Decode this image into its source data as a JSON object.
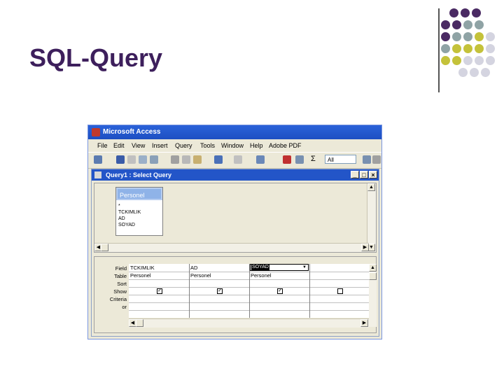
{
  "slide": {
    "title": "SQL-Query",
    "title_color": "#3d1f5c"
  },
  "app": {
    "title": "Microsoft Access",
    "menu": [
      "File",
      "Edit",
      "View",
      "Insert",
      "Query",
      "Tools",
      "Window",
      "Help",
      "Adobe PDF"
    ],
    "toolbar_combo_value": "All",
    "toolbar_sigma": "Σ"
  },
  "query_window": {
    "title": "Query1 : Select Query",
    "buttons": [
      "_",
      "□",
      "×"
    ],
    "table": {
      "name": "Personel",
      "fields": [
        "*",
        "TCKIMLIK",
        "AD",
        "SOYAD"
      ]
    }
  },
  "design_grid": {
    "row_labels": [
      "Field",
      "Table",
      "Sort",
      "Show",
      "Criteria",
      "or"
    ],
    "columns": [
      {
        "field": "TCKIMLIK",
        "table": "Personel",
        "show": true
      },
      {
        "field": "AD",
        "table": "Personel",
        "show": true
      },
      {
        "field": "SOYAD",
        "table": "Personel",
        "show": true,
        "selected": true
      },
      {
        "field": "",
        "table": "",
        "show": false
      }
    ]
  },
  "colors": {
    "purple": "#4a2a63",
    "gray": "#8fa3a5",
    "olive": "#c4c23a",
    "light": "#d4d4e0",
    "titlebar": "#2a62d9"
  }
}
